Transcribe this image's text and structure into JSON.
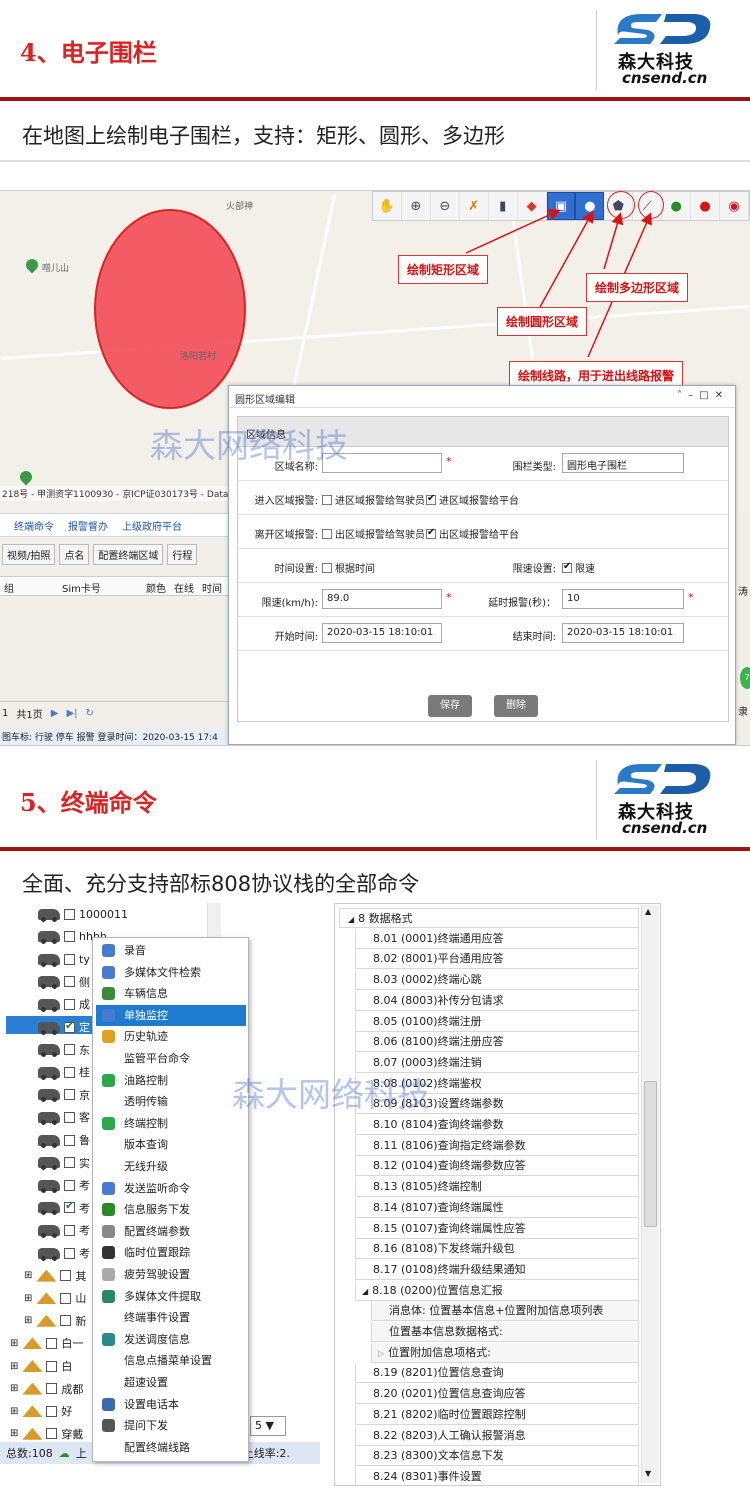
{
  "section1": {
    "title": "4、电子围栏",
    "logo_cn": "森大科技",
    "logo_en": "cnsend.cn",
    "caption": "在地图上绘制电子围栏，支持：矩形、圆形、多边形"
  },
  "map": {
    "label_top": "火部神",
    "label_mountain": "噌儿山",
    "label_village": "洛阳若村",
    "copyright": "218号 - 甲测资字1100930 - 京ICP证030173号 - Data © 长地",
    "callouts": {
      "rect": "绘制矩形区域",
      "circle": "绘制圆形区域",
      "polygon": "绘制多边形区域",
      "line": "绘制线路，用于进出线路报警"
    },
    "tabs": [
      "终端命令",
      "报警督办",
      "上级政府平台"
    ],
    "toolbar": [
      "视频/拍照",
      "点名",
      "配置终端区域",
      "行程"
    ],
    "columns": [
      "组",
      "Sim卡号",
      "颜色",
      "在线",
      "时间"
    ],
    "pager": {
      "page": "1",
      "total": "共1页"
    },
    "status": "图车标: 行驶 停车 报警 登录时间：2020-03-15 17:4",
    "right_text": "涛",
    "right_btn": "7",
    "right_bottom": "隶"
  },
  "dialog": {
    "title": "圆形区域编辑",
    "panel": "区域信息",
    "labels": {
      "name": "区域名称:",
      "type": "围栏类型:",
      "enter": "进入区域报警:",
      "leave": "离开区域报警:",
      "time": "时间设置:",
      "speed_set": "限速设置:",
      "speed": "限速(km/h):",
      "delay": "延时报警(秒)：",
      "start": "开始时间:",
      "end": "结束时间:"
    },
    "values": {
      "type": "圆形电子围栏",
      "speed": "89.0",
      "delay": "10",
      "start": "2020-03-15 18:10:01",
      "end": "2020-03-15 18:10:01"
    },
    "checks": {
      "enter_driver": "进区域报警给驾驶员",
      "enter_platform": "进区域报警给平台",
      "leave_driver": "出区域报警给驾驶员",
      "leave_platform": "出区域报警给平台",
      "by_time": "根据时间",
      "limit": "限速"
    },
    "buttons": {
      "save": "保存",
      "delete": "删除"
    }
  },
  "watermark": "森大网络科技",
  "section2": {
    "title": "5、终端命令",
    "logo_cn": "森大科技",
    "logo_en": "cnsend.cn",
    "caption": "全面、充分支持部标808协议栈的全部命令"
  },
  "tree": {
    "rows": [
      "1000011",
      "hhhh",
      "ty",
      "侧",
      "成",
      "定",
      "东",
      "桂",
      "京",
      "客",
      "鲁",
      "实",
      "考",
      "考",
      "考",
      "考",
      "其",
      "山",
      "新",
      "白一",
      "白",
      "成都",
      "好",
      "穿戴"
    ],
    "status": "总数:108",
    "status_online": "上",
    "status_rate": "上线率:2.",
    "page_size": "5"
  },
  "context_menu": [
    "录音",
    "多媒体文件检索",
    "车辆信息",
    "单独监控",
    "历史轨迹",
    "监管平台命令",
    "油路控制",
    "透明传输",
    "终端控制",
    "版本查询",
    "无线升级",
    "发送监听命令",
    "信息服务下发",
    "配置终端参数",
    "临时位置跟踪",
    "疲劳驾驶设置",
    "多媒体文件提取",
    "终端事件设置",
    "发送调度信息",
    "信息点播菜单设置",
    "超速设置",
    "设置电话本",
    "提问下发",
    "配置终端线路"
  ],
  "protocol": {
    "root": "8 数据格式",
    "items": [
      "8.01 (0001)终端通用应答",
      "8.02 (8001)平台通用应答",
      "8.03 (0002)终端心跳",
      "8.04 (8003)补传分包请求",
      "8.05 (0100)终端注册",
      "8.06 (8100)终端注册应答",
      "8.07 (0003)终端注销",
      "8.08 (0102)终端鉴权",
      "8.09 (8103)设置终端参数",
      "8.10 (8104)查询终端参数",
      "8.11 (8106)查询指定终端参数",
      "8.12 (0104)查询终端参数应答",
      "8.13 (8105)终端控制",
      "8.14 (8107)查询终端属性",
      "8.15 (0107)查询终端属性应答",
      "8.16 (8108)下发终端升级包",
      "8.17 (0108)终端升级结果通知",
      "8.18 (0200)位置信息汇报"
    ],
    "sub_items": [
      "消息体: 位置基本信息+位置附加信息项列表",
      "位置基本信息数据格式:",
      "位置附加信息项格式:"
    ],
    "items_after": [
      "8.19 (8201)位置信息查询",
      "8.20 (0201)位置信息查询应答",
      "8.21 (8202)临时位置跟踪控制",
      "8.22 (8203)人工确认报警消息",
      "8.23 (8300)文本信息下发",
      "8.24 (8301)事件设置"
    ]
  },
  "colors": {
    "accent": "#a01212",
    "title_red": "#dd2222",
    "fence_red": "#f3505a",
    "highlight_blue": "#1e7bd0"
  }
}
